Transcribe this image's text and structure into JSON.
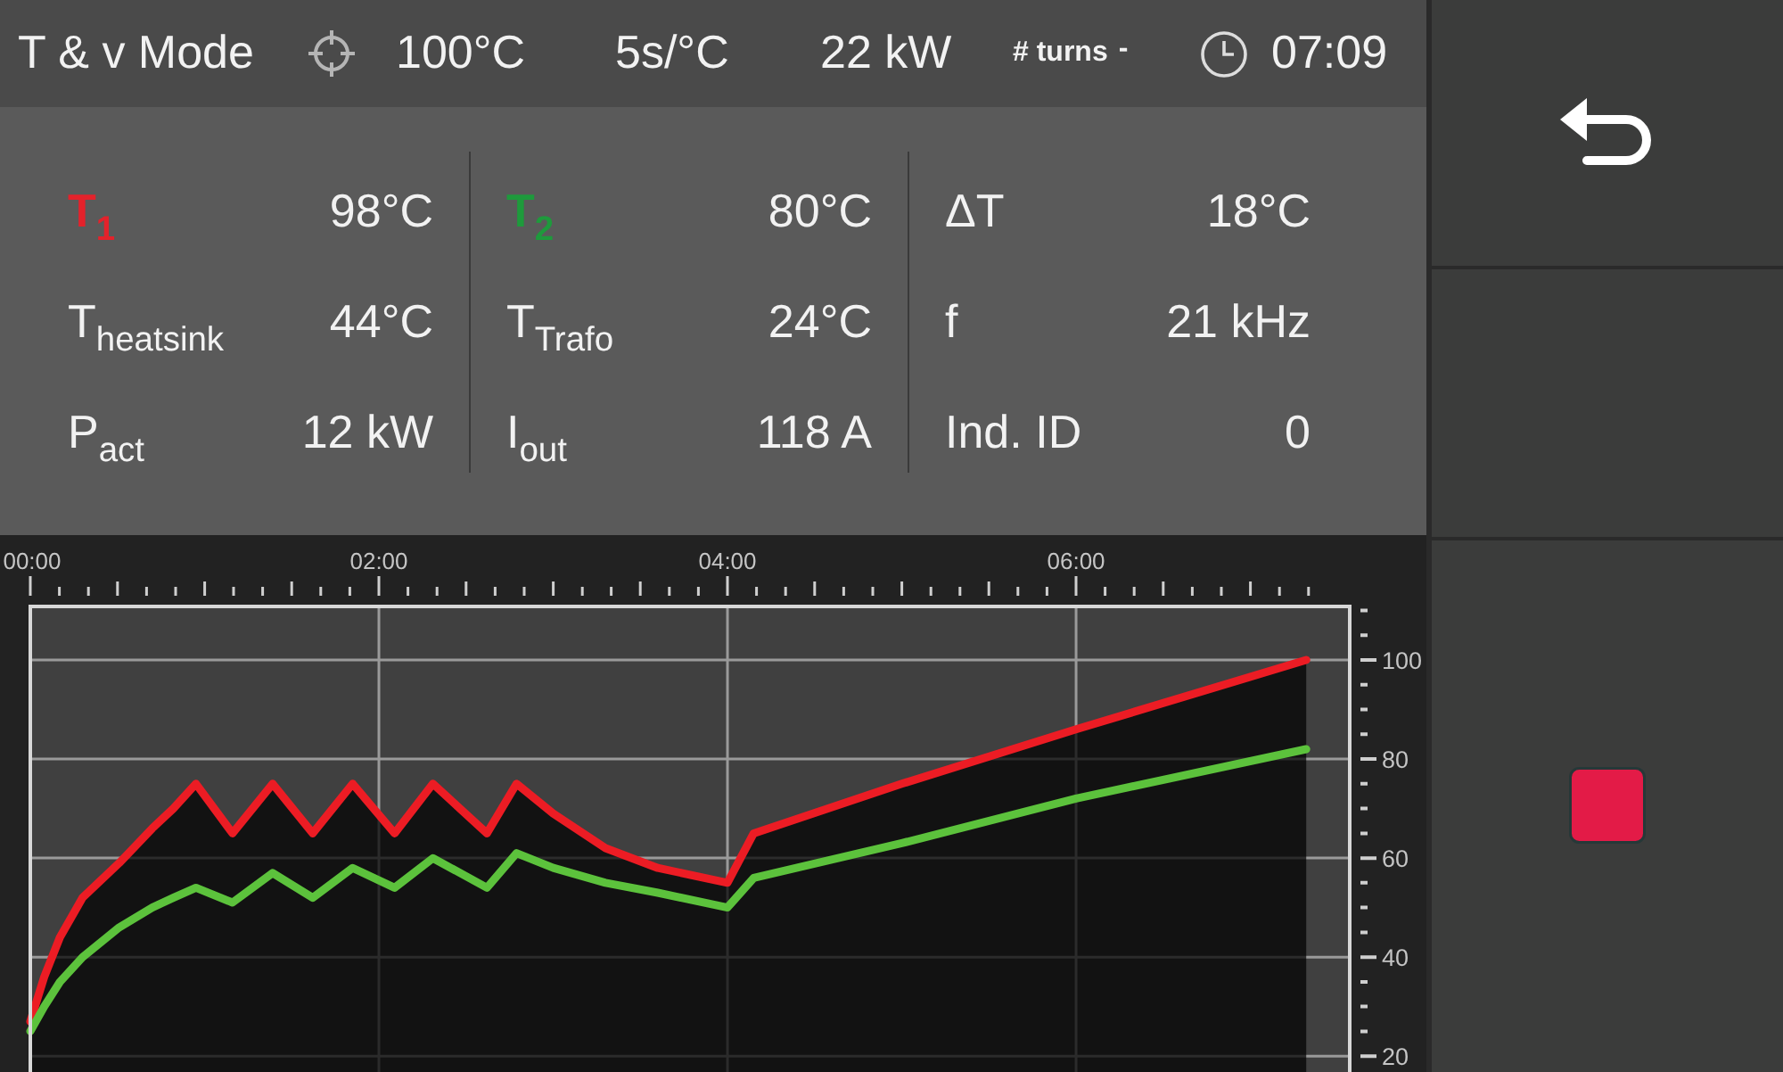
{
  "header": {
    "mode": "T & v Mode",
    "setpoint": "100°C",
    "rate": "5s/°C",
    "power": "22 kW",
    "turns_label": "# turns",
    "turns_value": "-",
    "time": "07:09"
  },
  "reading_columns": [
    {
      "cells": [
        {
          "label": "T$_{1}$",
          "value": "98°C",
          "color": "#e3222b"
        },
        {
          "label": "T$_{heatsink}$",
          "value": "44°C"
        },
        {
          "label": "P$_{act}$",
          "value": "12 kW"
        }
      ]
    },
    {
      "cells": [
        {
          "label": "T$_{2}$",
          "value": "80°C",
          "color": "#1e9a3c"
        },
        {
          "label": "T$_{Trafo}$",
          "value": "24°C"
        },
        {
          "label": "I$_{out}$",
          "value": "118 A"
        }
      ]
    },
    {
      "cells": [
        {
          "label": "ΔT",
          "value": "18°C"
        },
        {
          "label": "f",
          "value": "21 kHz"
        },
        {
          "label": "Ind. ID",
          "value": "0"
        }
      ]
    }
  ],
  "chart": {
    "chart_data": {
      "type": "area",
      "x": [
        0,
        0.08,
        0.17,
        0.3,
        0.51,
        0.7,
        0.82,
        0.95,
        1.16,
        1.39,
        1.62,
        1.85,
        2.09,
        2.31,
        2.62,
        2.79,
        3.0,
        3.3,
        3.6,
        4.0,
        4.15,
        5.0,
        6.0,
        7.32
      ],
      "series": [
        {
          "color": "#ec1c24",
          "values": [
            27,
            36,
            44,
            52,
            59,
            66,
            70,
            75,
            65,
            75,
            65,
            75,
            65,
            75,
            65,
            75,
            69,
            62,
            58,
            55,
            65,
            75,
            86,
            100
          ]
        },
        {
          "type": "line",
          "color": "#5cc23c",
          "values": [
            25,
            30,
            35,
            40,
            46,
            50,
            52,
            54,
            51,
            57,
            52,
            58,
            54,
            60,
            54,
            61,
            58,
            55,
            53,
            50,
            56,
            63,
            72,
            82
          ]
        }
      ],
      "xlim": [
        0,
        7.57
      ],
      "ylim": [
        16.8,
        110.8
      ],
      "xticks": [
        {
          "value": 0,
          "label": "00:00"
        },
        {
          "value": 2,
          "label": "02:00"
        },
        {
          "value": 4,
          "label": "04:00"
        },
        {
          "value": 6,
          "label": "06:00"
        }
      ],
      "yticks": [
        20,
        40,
        60,
        80,
        100
      ],
      "grid": true
    }
  },
  "side_buttons": [
    {
      "kind": "back"
    },
    {
      "kind": "blank"
    },
    {
      "kind": "stop"
    }
  ]
}
